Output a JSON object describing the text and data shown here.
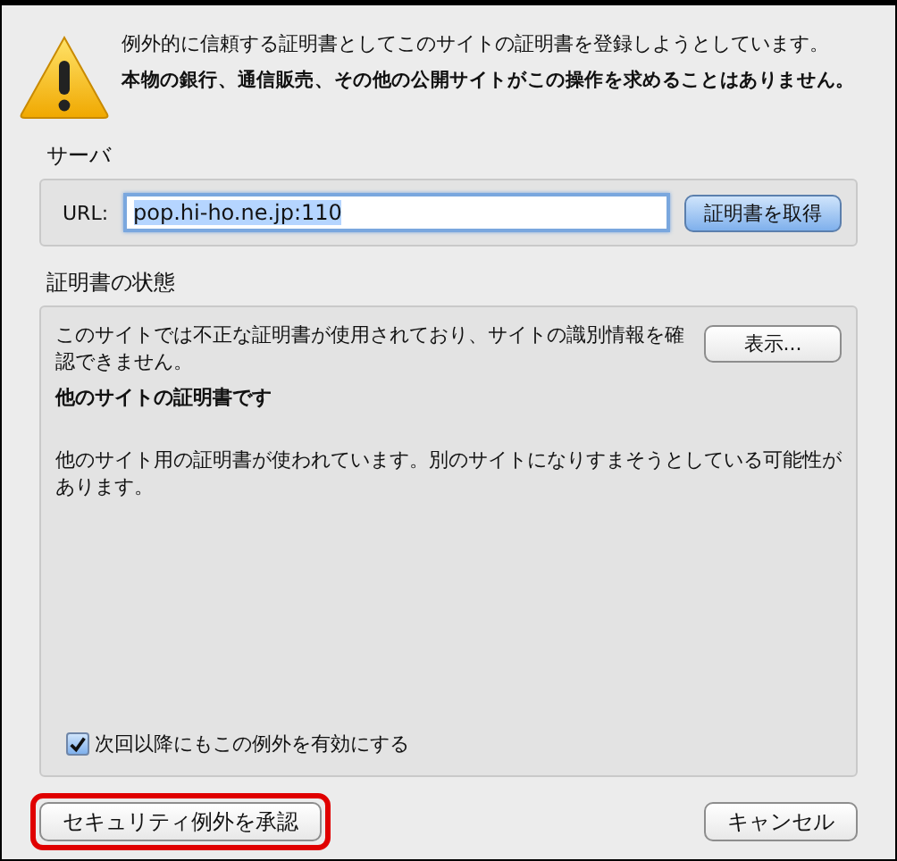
{
  "warning": {
    "message": "例外的に信頼する証明書としてこのサイトの証明書を登録しようとしています。",
    "emphasis": "本物の銀行、通信販売、その他の公開サイトがこの操作を求めることはありません。"
  },
  "server": {
    "heading": "サーバ",
    "url_label": "URL:",
    "url_value": "pop.hi-ho.ne.jp:110",
    "url_text_selected": true,
    "fetch_button": "証明書を取得"
  },
  "certificate_status": {
    "heading": "証明書の状態",
    "summary": "このサイトでは不正な証明書が使用されており、サイトの識別情報を確認できません。",
    "view_button": "表示...",
    "problem_title": "他のサイトの証明書です",
    "problem_detail": "他のサイト用の証明書が使われています。別のサイトになりすまそうとしている可能性があります。",
    "permanent_checkbox": {
      "label": "次回以降にもこの例外を有効にする",
      "checked": true
    }
  },
  "buttons": [
    {
      "label": "セキュリティ例外を承認",
      "kind": "confirm",
      "highlighted": true
    },
    {
      "label": "キャンセル",
      "kind": "cancel",
      "highlighted": false
    }
  ]
}
